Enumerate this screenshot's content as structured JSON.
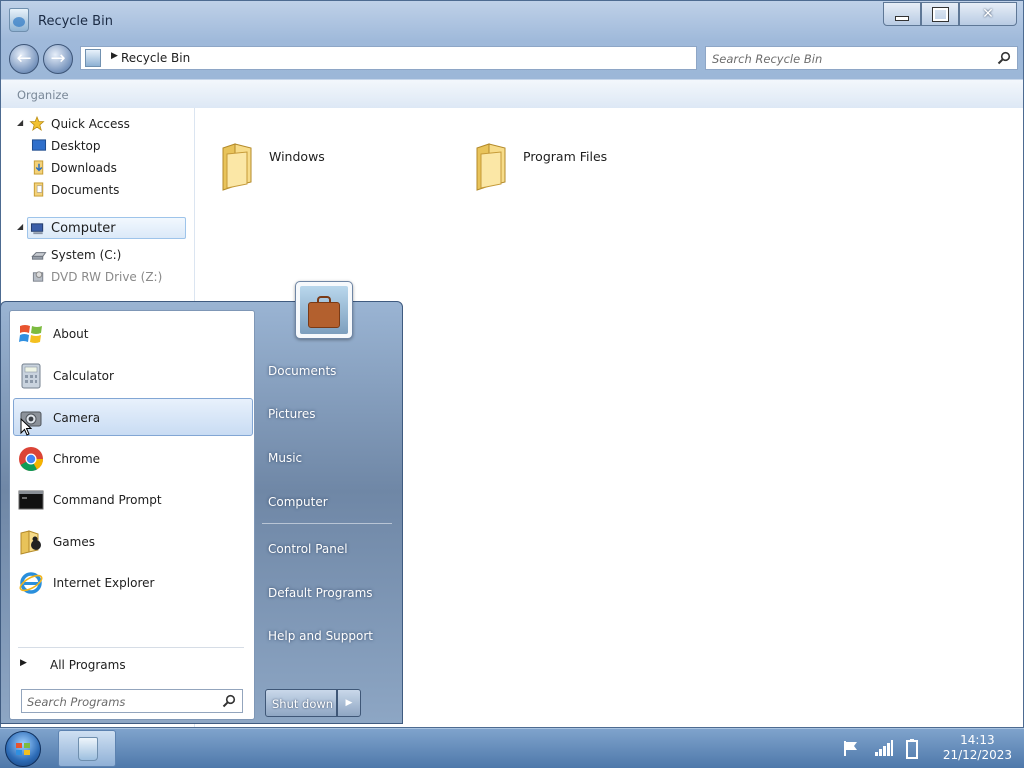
{
  "window": {
    "title": "Recycle Bin",
    "address": "Recycle Bin",
    "search_placeholder": "Search Recycle Bin",
    "toolbar_organize": "Organize",
    "controls": {
      "minimize": "minimize",
      "maximize": "maximize",
      "close": "✕"
    }
  },
  "sidebar": {
    "quick_access": "Quick Access",
    "desktop": "Desktop",
    "downloads": "Downloads",
    "documents": "Documents",
    "computer": "Computer",
    "system_c": "System (C:)",
    "dvd_drive": "DVD RW Drive (Z:)"
  },
  "content": {
    "folders": [
      {
        "name": "Windows"
      },
      {
        "name": "Program Files"
      }
    ]
  },
  "start_menu": {
    "programs": [
      {
        "label": "About",
        "icon": "windows-logo-icon"
      },
      {
        "label": "Calculator",
        "icon": "calculator-icon"
      },
      {
        "label": "Camera",
        "icon": "camera-icon"
      },
      {
        "label": "Chrome",
        "icon": "chrome-icon"
      },
      {
        "label": "Command Prompt",
        "icon": "command-prompt-icon"
      },
      {
        "label": "Games",
        "icon": "games-icon"
      },
      {
        "label": "Internet Explorer",
        "icon": "internet-explorer-icon"
      }
    ],
    "highlighted_program": "Camera",
    "all_programs": "All Programs",
    "search_placeholder": "Search Programs",
    "places": {
      "documents": "Documents",
      "pictures": "Pictures",
      "music": "Music",
      "computer": "Computer",
      "control_panel": "Control Panel",
      "default_programs": "Default Programs",
      "help_support": "Help and Support"
    },
    "shutdown": "Shut down"
  },
  "taskbar": {
    "time": "14:13",
    "date": "21/12/2023",
    "pinned_app_icon": "recycle-bin-icon"
  }
}
